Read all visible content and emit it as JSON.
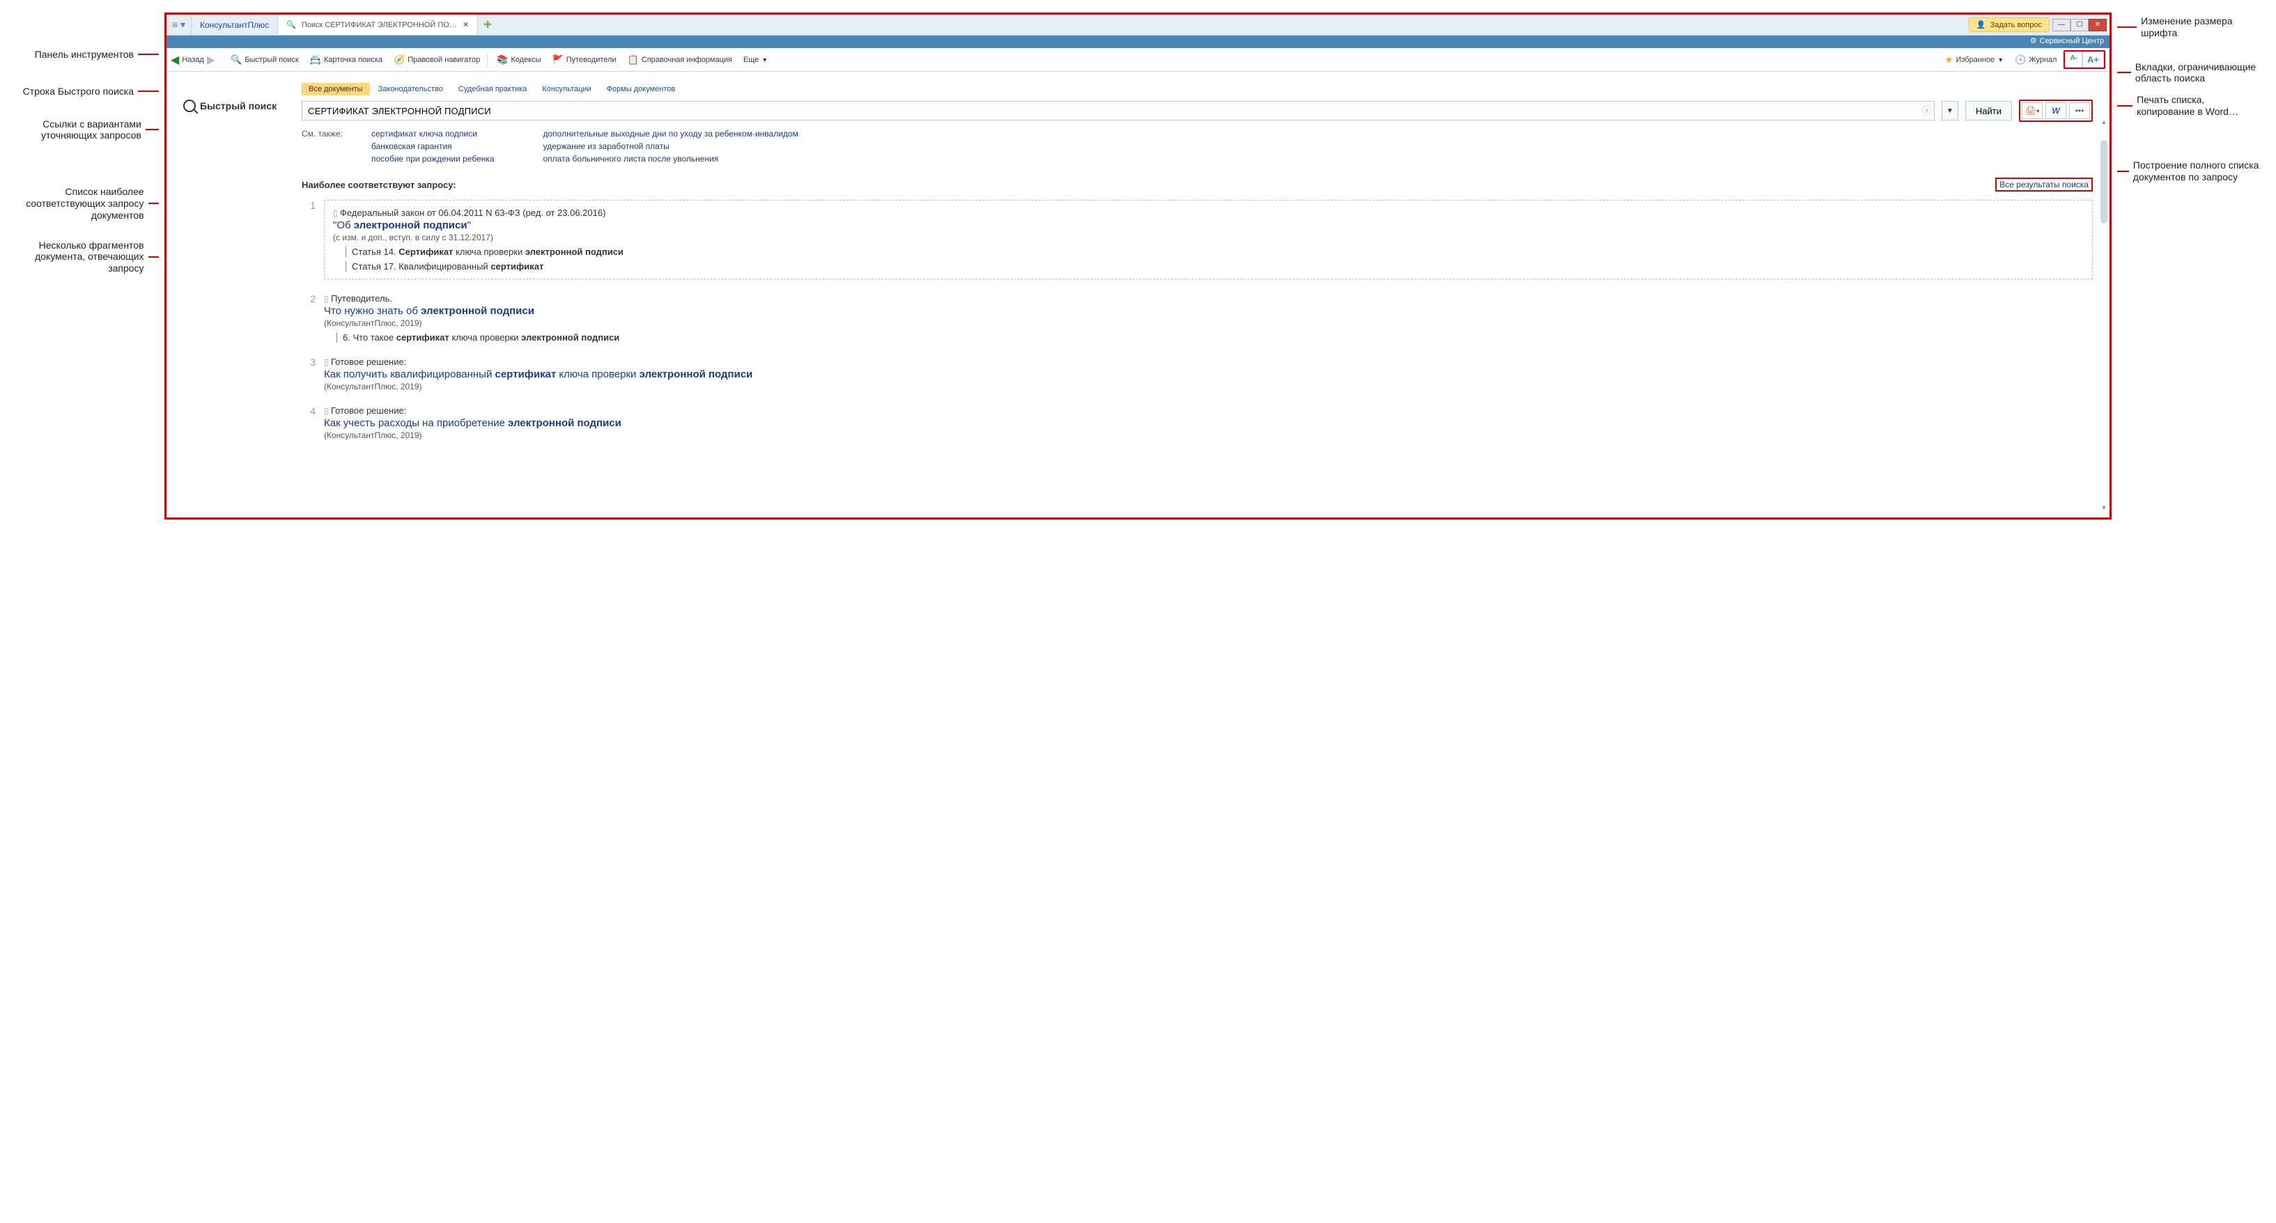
{
  "annotations": {
    "left": {
      "toolbar": "Панель инструментов",
      "quick_search_row": "Строка Быстрого поиска",
      "refine_links": "Ссылки с вариантами уточняющих запросов",
      "top_docs": "Список наиболее соответствующих запросу документов",
      "fragments": "Несколько фрагментов документа, отвечающих запросу"
    },
    "right": {
      "font_size": "Изменение размера шрифта",
      "scope_tabs": "Вкладки, ограничивающие область поиска",
      "print_copy": "Печать списка, копирование в Word…",
      "full_list": "Построение полного списка документов по запросу"
    }
  },
  "titlebar": {
    "app_name": "КонсультантПлюс",
    "tab_label": "Поиск СЕРТИФИКАТ ЭЛЕКТРОННОЙ ПО…",
    "ask_question": "Задать вопрос",
    "service_center": "Сервисный Центр"
  },
  "toolbar": {
    "back": "Назад",
    "quick_search": "Быстрый поиск",
    "card_search": "Карточка поиска",
    "legal_nav": "Правовой навигатор",
    "codexes": "Кодексы",
    "guides": "Путеводители",
    "ref_info": "Справочная информация",
    "more": "Еще",
    "favorites": "Избранное",
    "journal": "Журнал",
    "font_minus": "A-",
    "font_plus": "A+"
  },
  "quick_search_label": "Быстрый поиск",
  "scope_tabs": {
    "all": "Все документы",
    "law": "Законодательство",
    "court": "Судебная практика",
    "consult": "Консультации",
    "forms": "Формы документов"
  },
  "search": {
    "value": "СЕРТИФИКАТ ЭЛЕКТРОННОЙ ПОДПИСИ",
    "find": "Найти"
  },
  "see_also": {
    "label": "См. также:",
    "col1": {
      "a": "сертификат ключа подписи",
      "b": "банковская гарантия",
      "c": "пособие при рождении ребенка"
    },
    "col2": {
      "a": "дополнительные выходные дни по уходу за ребенком-инвалидом",
      "b": "удержание из заработной платы",
      "c": "оплата больничного листа после увольнения"
    }
  },
  "results_header": {
    "title": "Наиболее соответствуют запросу:",
    "all_link": "Все результаты поиска"
  },
  "results": {
    "r1": {
      "num": "1",
      "meta": "Федеральный закон от 06.04.2011 N 63-ФЗ (ред. от 23.06.2016)",
      "title_pre": "\"Об ",
      "title_b": "электронной подписи",
      "title_post": "\"",
      "sub": "(с изм. и доп., вступ. в силу с 31.12.2017)",
      "frag1_pre": "Статья 14. ",
      "frag1_b1": "Сертификат",
      "frag1_mid": " ключа проверки ",
      "frag1_b2": "электронной подписи",
      "frag2_pre": "Статья 17. Квалифицированный ",
      "frag2_b": "сертификат"
    },
    "r2": {
      "num": "2",
      "meta": "Путеводитель.",
      "title_pre": "Что нужно знать об ",
      "title_b": "электронной подписи",
      "sub": "(КонсультантПлюс, 2019)",
      "frag_pre": "6. Что такое ",
      "frag_b1": "сертификат",
      "frag_mid": " ключа проверки ",
      "frag_b2": "электронной подписи"
    },
    "r3": {
      "num": "3",
      "meta": "Готовое решение:",
      "title_pre": "Как получить квалифицированный ",
      "title_b1": "сертификат",
      "title_mid": " ключа проверки ",
      "title_b2": "электронной подписи",
      "sub": "(КонсультантПлюс, 2019)"
    },
    "r4": {
      "num": "4",
      "meta": "Готовое решение:",
      "title_pre": "Как учесть расходы на приобретение ",
      "title_b": "электронной подписи",
      "sub": "(КонсультантПлюс, 2019)"
    }
  }
}
